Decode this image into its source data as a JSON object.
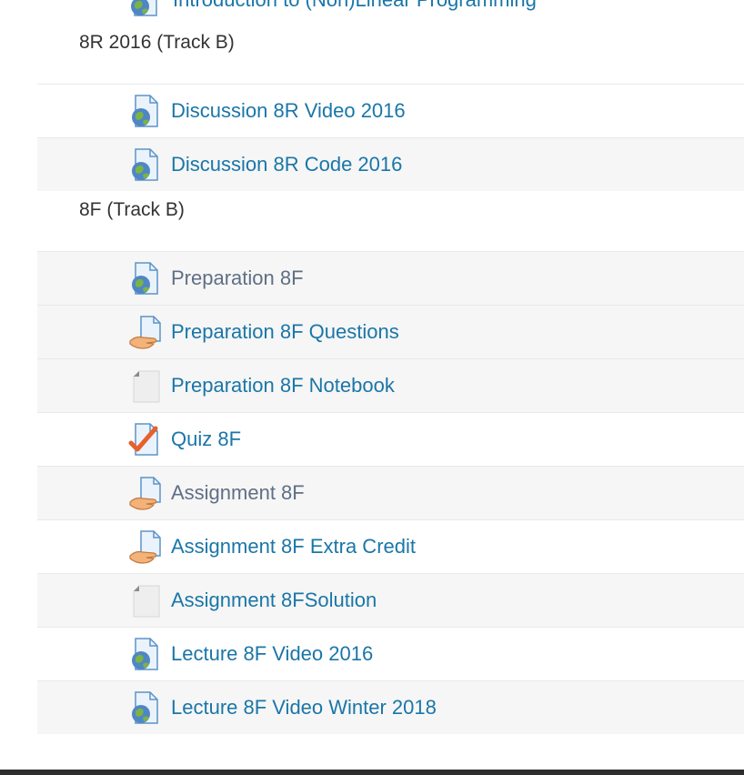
{
  "top_item": {
    "label": "Introduction to (Non)Linear Programming",
    "icon": "url-globe-icon"
  },
  "sections": [
    {
      "heading": "8R 2016 (Track B)",
      "items": [
        {
          "label": "Discussion 8R Video 2016",
          "icon": "url-globe-icon",
          "status": "link"
        },
        {
          "label": "Discussion 8R Code 2016",
          "icon": "url-globe-icon",
          "status": "link"
        }
      ]
    },
    {
      "heading": "8F (Track B)",
      "items": [
        {
          "label": "Preparation 8F",
          "icon": "url-globe-icon",
          "status": "dimmed"
        },
        {
          "label": "Preparation 8F Questions",
          "icon": "assignment-hand-icon",
          "status": "link"
        },
        {
          "label": "Preparation 8F Notebook",
          "icon": "file-icon",
          "status": "link"
        },
        {
          "label": "Quiz 8F",
          "icon": "quiz-check-icon",
          "status": "link"
        },
        {
          "label": "Assignment 8F",
          "icon": "assignment-hand-icon",
          "status": "dimmed"
        },
        {
          "label": "Assignment 8F Extra Credit",
          "icon": "assignment-hand-icon",
          "status": "link"
        },
        {
          "label": "Assignment 8FSolution",
          "icon": "file-icon",
          "status": "link"
        },
        {
          "label": "Lecture 8F Video 2016",
          "icon": "url-globe-icon",
          "status": "link"
        },
        {
          "label": "Lecture 8F Video Winter 2018",
          "icon": "url-globe-icon",
          "status": "link"
        }
      ]
    }
  ],
  "colors": {
    "link": "#1a76a8",
    "dimmed": "#5f6f85",
    "heading": "#333333",
    "row_alt": "#f6f6f6"
  }
}
